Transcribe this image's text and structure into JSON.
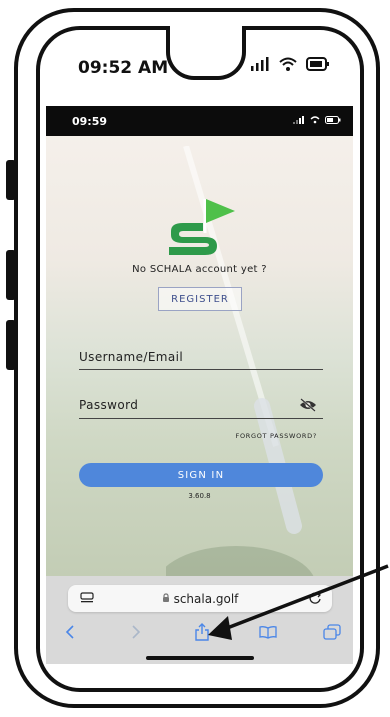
{
  "device": {
    "status_time": "09:52 AM"
  },
  "app": {
    "status_time": "09:59",
    "no_account_text": "No SCHALA account yet ?",
    "register_label": "REGISTER",
    "username_label": "Username/Email",
    "password_label": "Password",
    "forgot_label": "FORGOT PASSWORD?",
    "signin_label": "SIGN IN",
    "version": "3.60.8",
    "colors": {
      "accent_blue": "#4f87db",
      "logo_green": "#2e9a4a",
      "logo_light_green": "#4fc04a"
    }
  },
  "browser": {
    "host": "schala.golf",
    "icons": [
      "menu-icon",
      "lock-icon",
      "reload-icon",
      "back-icon",
      "forward-icon",
      "share-icon",
      "bookmarks-icon",
      "tabs-icon"
    ]
  }
}
